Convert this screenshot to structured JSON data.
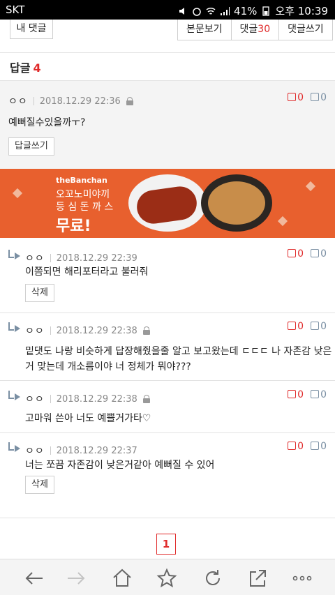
{
  "status_bar": {
    "carrier": "SKT",
    "battery": "41%",
    "time": "오후 10:39"
  },
  "toolbar": {
    "my_comments": "내 댓글",
    "view_post": "본문보기",
    "comments_label": "댓글",
    "comments_count": "30",
    "write_comment": "댓글쓰기"
  },
  "replies_header": {
    "label": "답글",
    "count": "4"
  },
  "main_comment": {
    "nick": "ㅇㅇ",
    "date": "2018.12.29 22:36",
    "up": "0",
    "down": "0",
    "text": "예뻐질수있을까ㅜ?",
    "reply_button": "답글쓰기"
  },
  "ad": {
    "brand": "theBanchan",
    "line1": "오꼬노미야끼",
    "line2": "등 심 돈 까 스",
    "free": "무료!"
  },
  "replies": [
    {
      "nick": "ㅇㅇ",
      "date": "2018.12.29 22:39",
      "locked": false,
      "up": "0",
      "down": "0",
      "text1": "이쯤되면 해리포터라고 불러줘",
      "text2": "",
      "delete_label": "삭제"
    },
    {
      "nick": "ㅇㅇ",
      "date": "2018.12.29 22:38",
      "locked": true,
      "up": "0",
      "down": "0",
      "text1": "밑댓도 나랑 비슷하게 답장해줬을줄 알고 보고왔는데 ㄷㄷㄷ 나 자존감 낮은",
      "text2": "거 맞는데 개소름이야 너 정체가 뭐야???",
      "delete_label": ""
    },
    {
      "nick": "ㅇㅇ",
      "date": "2018.12.29 22:38",
      "locked": true,
      "up": "0",
      "down": "0",
      "text1": "고마워 쓴아 너도 예쁠거가타♡",
      "text2": "",
      "delete_label": ""
    },
    {
      "nick": "ㅇㅇ",
      "date": "2018.12.29 22:37",
      "locked": false,
      "up": "0",
      "down": "0",
      "text1": "너는 쪼끔 자존감이 낮은거같아 예뻐질 수 있어",
      "text2": "",
      "delete_label": "삭제"
    }
  ],
  "pagination": {
    "current": "1"
  },
  "colors": {
    "accent": "#e02b2b",
    "ad_bg": "#e8602e",
    "muted": "#7a8fa3"
  }
}
